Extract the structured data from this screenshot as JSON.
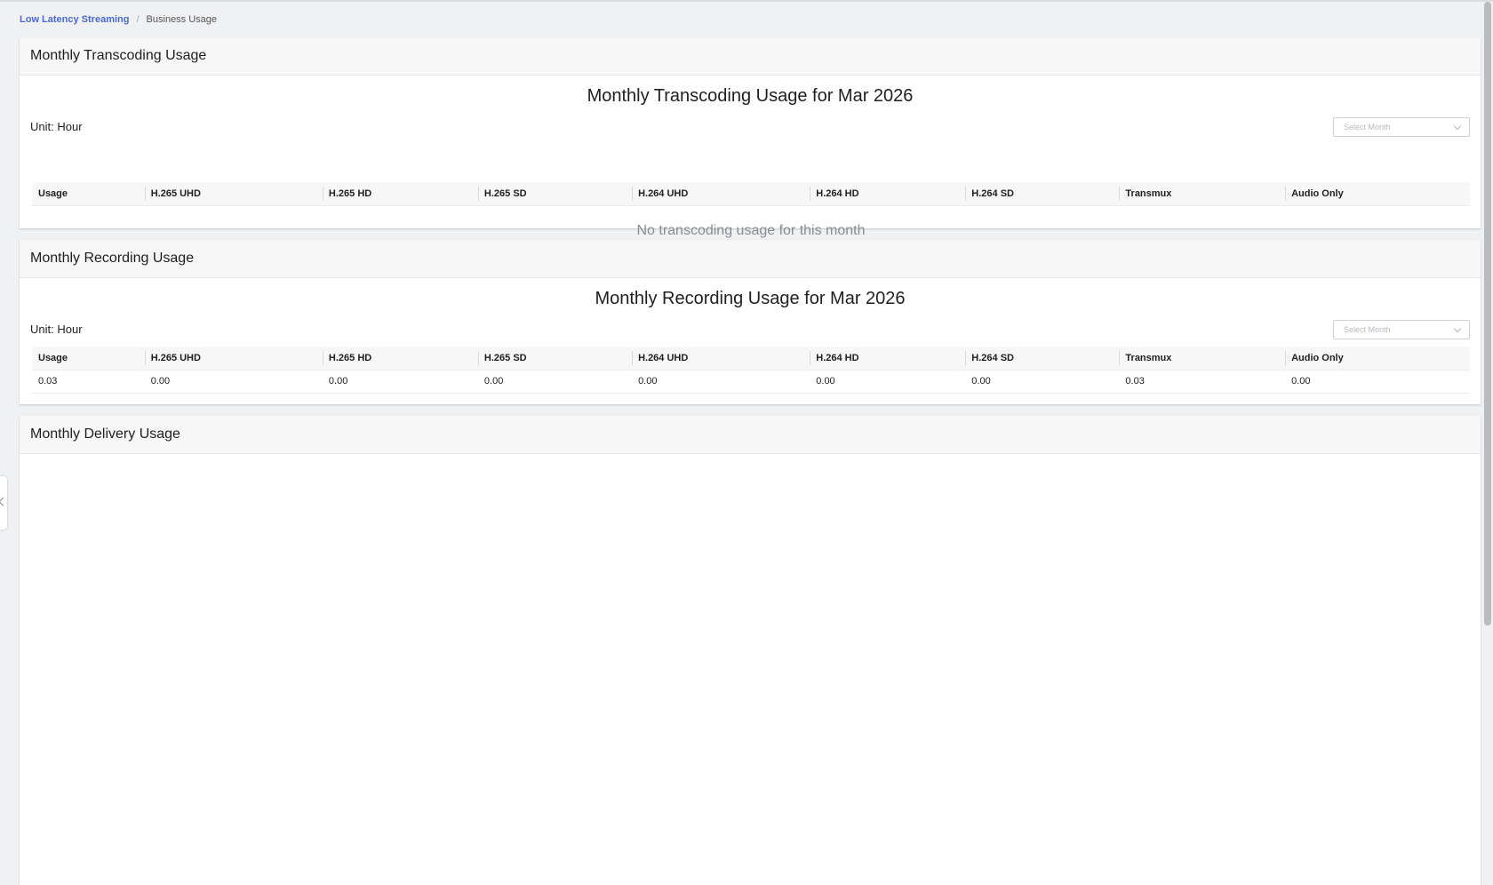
{
  "breadcrumb": {
    "root": "Low Latency Streaming",
    "separator": "/",
    "current": "Business Usage"
  },
  "transcoding": {
    "header": "Monthly Transcoding Usage",
    "title": "Monthly Transcoding Usage for Mar 2026",
    "unit": "Unit: Hour",
    "select_placeholder": "Select Month",
    "columns": [
      "Usage",
      "H.265 UHD",
      "H.265 HD",
      "H.265 SD",
      "H.264 UHD",
      "H.264 HD",
      "H.264 SD",
      "Transmux",
      "Audio Only"
    ],
    "empty_text": "No transcoding usage for this month"
  },
  "recording": {
    "header": "Monthly Recording Usage",
    "title": "Monthly Recording Usage for Mar 2026",
    "unit": "Unit: Hour",
    "select_placeholder": "Select Month",
    "columns": [
      "Usage",
      "H.265 UHD",
      "H.265 HD",
      "H.265 SD",
      "H.264 UHD",
      "H.264 HD",
      "H.264 SD",
      "Transmux",
      "Audio Only"
    ],
    "rows": [
      [
        "0.03",
        "0.00",
        "0.00",
        "0.00",
        "0.00",
        "0.00",
        "0.00",
        "0.03",
        "0.00"
      ]
    ]
  },
  "delivery": {
    "header": "Monthly Delivery Usage"
  },
  "icons": {
    "select_chevron": "chevron-down-icon",
    "side_collapse": "chevron-left-icon"
  }
}
